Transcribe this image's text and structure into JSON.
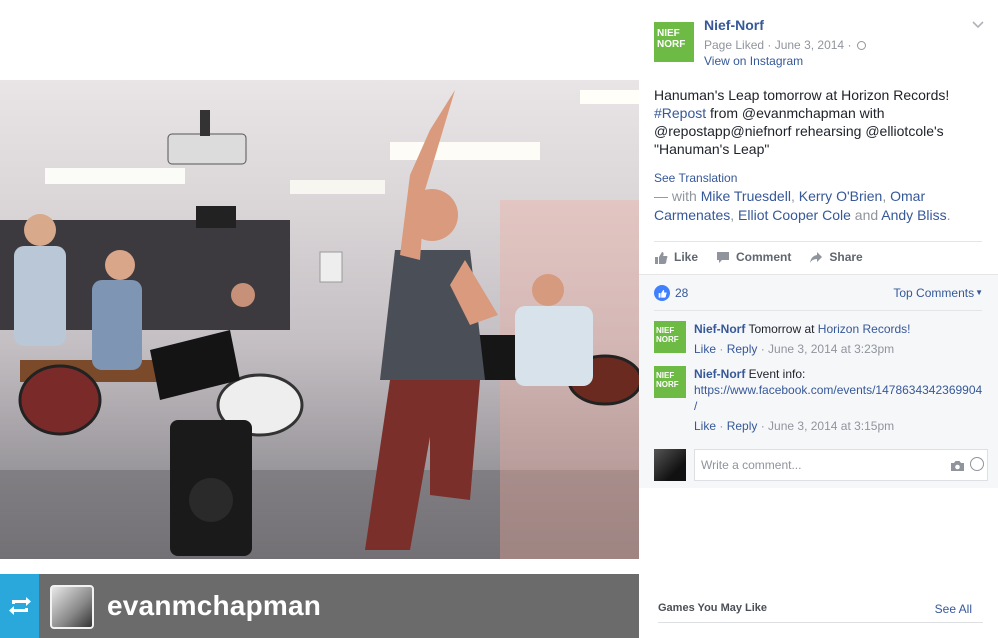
{
  "post": {
    "page_name": "Nief-Norf",
    "page_logo_text": "NIEF NORF",
    "meta": "Page Liked · June 3, 2014 ·",
    "view_on": "View on Instagram",
    "text_line1": "Hanuman's Leap tomorrow at Horizon Records!",
    "hashtag": "#Repost",
    "text_line2": " from @evanmchapman with @repostapp@niefnorf rehearsing @elliotcole's \"Hanuman's Leap\"",
    "see_translation": "See Translation",
    "with_prefix": " — with ",
    "tagged": [
      "Mike Truesdell",
      "Kerry O'Brien",
      "Omar Carmenates",
      "Elliot Cooper Cole",
      "Andy Bliss"
    ],
    "with_sep": ", ",
    "with_and": " and ",
    "with_end": "."
  },
  "actions": {
    "like": "Like",
    "comment": "Comment",
    "share": "Share"
  },
  "reactions": {
    "count": "28",
    "top_comments": "Top Comments"
  },
  "comments": [
    {
      "author": "Nief-Norf",
      "text_before": " Tomorrow at ",
      "link": "Horizon Records!",
      "like": "Like",
      "reply": "Reply",
      "time": " · June 3, 2014 at 3:23pm"
    },
    {
      "author": "Nief-Norf",
      "text_before": " Event info: ",
      "link": "https://www.facebook.com/events/1478634342369904/",
      "like": "Like",
      "reply": "Reply",
      "time": " · June 3, 2014 at 3:15pm"
    }
  ],
  "composer": {
    "placeholder": "Write a comment..."
  },
  "repost_bar": {
    "username": "evanmchapman"
  },
  "games": {
    "heading": "Games You May Like",
    "see_all": "See All"
  },
  "colors": {
    "link": "#365899",
    "brand_green": "#6dbb45",
    "repost_blue": "#2aa8dc"
  }
}
